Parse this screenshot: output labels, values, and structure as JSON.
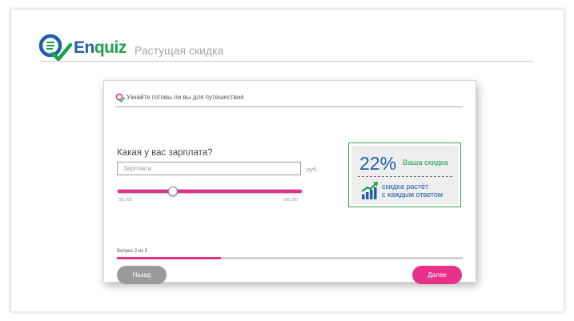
{
  "brand": {
    "name_part1": "En",
    "name_part2": "quiz",
    "colors": {
      "blue": "#1f5fa8",
      "green": "#19a34a",
      "pink": "#e8318a"
    }
  },
  "header": {
    "subtitle": "Растущая скидка"
  },
  "card": {
    "title": "Узнайте готовы ли вы для путешествия",
    "question": "Какая у вас зарплата?",
    "salary_input": {
      "placeholder": "Зарплата",
      "value": ""
    },
    "currency": "руб.",
    "slider": {
      "min_label": "100 000",
      "max_label": "300 000",
      "min": 100000,
      "max": 300000,
      "position_fraction": 0.3
    },
    "discount": {
      "value": "22%",
      "label": "Ваша скидка",
      "growth_line1": "скидка растёт",
      "growth_line2": "с каждым ответом"
    },
    "progress": {
      "label": "Вопрос 2 из 5",
      "fraction": 0.3
    },
    "buttons": {
      "back": "Назад",
      "next": "Далее"
    }
  },
  "icons": [
    "search-list-check-icon",
    "growth-chart-icon",
    "small-quiz-icon"
  ]
}
